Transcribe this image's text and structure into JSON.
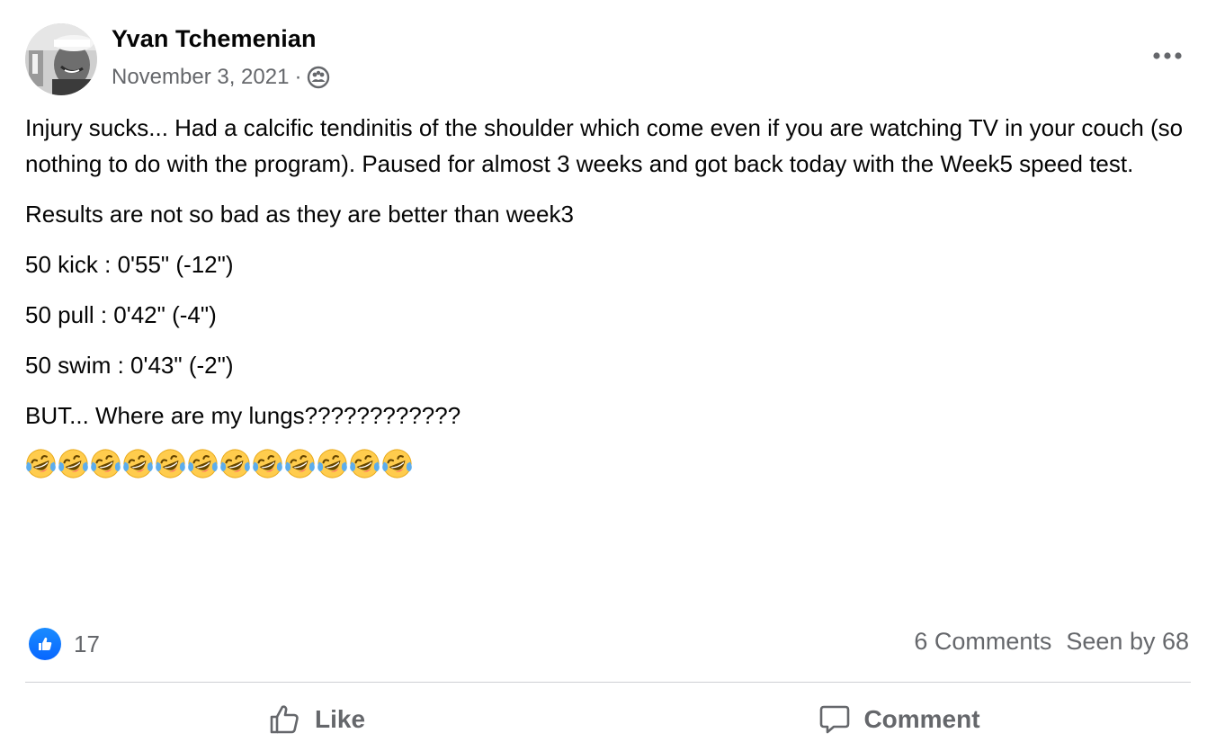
{
  "post": {
    "author": "Yvan Tchemenian",
    "date": "November 3, 2021",
    "date_separator": "·",
    "privacy_icon": "group-icon",
    "more_icon": "more-horizontal-icon",
    "paragraphs": [
      "Injury sucks... Had a calcific tendinitis of the shoulder which come even if you are watching TV in your couch (so nothing to do with the program). Paused for almost 3 weeks and got back today with the Week5 speed test.",
      "Results are not so bad as they are better than week3",
      "50 kick : 0'55\" (-12\")",
      "50 pull : 0'42\" (-4\")",
      "50 swim : 0'43\" (-2\")",
      "BUT... Where are my lungs????????????"
    ],
    "emoji_name": "rolling-on-floor-laughing-emoji",
    "emoji_count": 12
  },
  "reactions": {
    "icon": "like-icon",
    "count": "17"
  },
  "stats": {
    "comments": "6 Comments",
    "seen_by": "Seen by 68"
  },
  "actions": {
    "like_label": "Like",
    "comment_label": "Comment"
  },
  "colors": {
    "text_primary": "#050505",
    "text_secondary": "#65676b",
    "like_blue": "#0866ff",
    "divider": "#ced0d4"
  }
}
